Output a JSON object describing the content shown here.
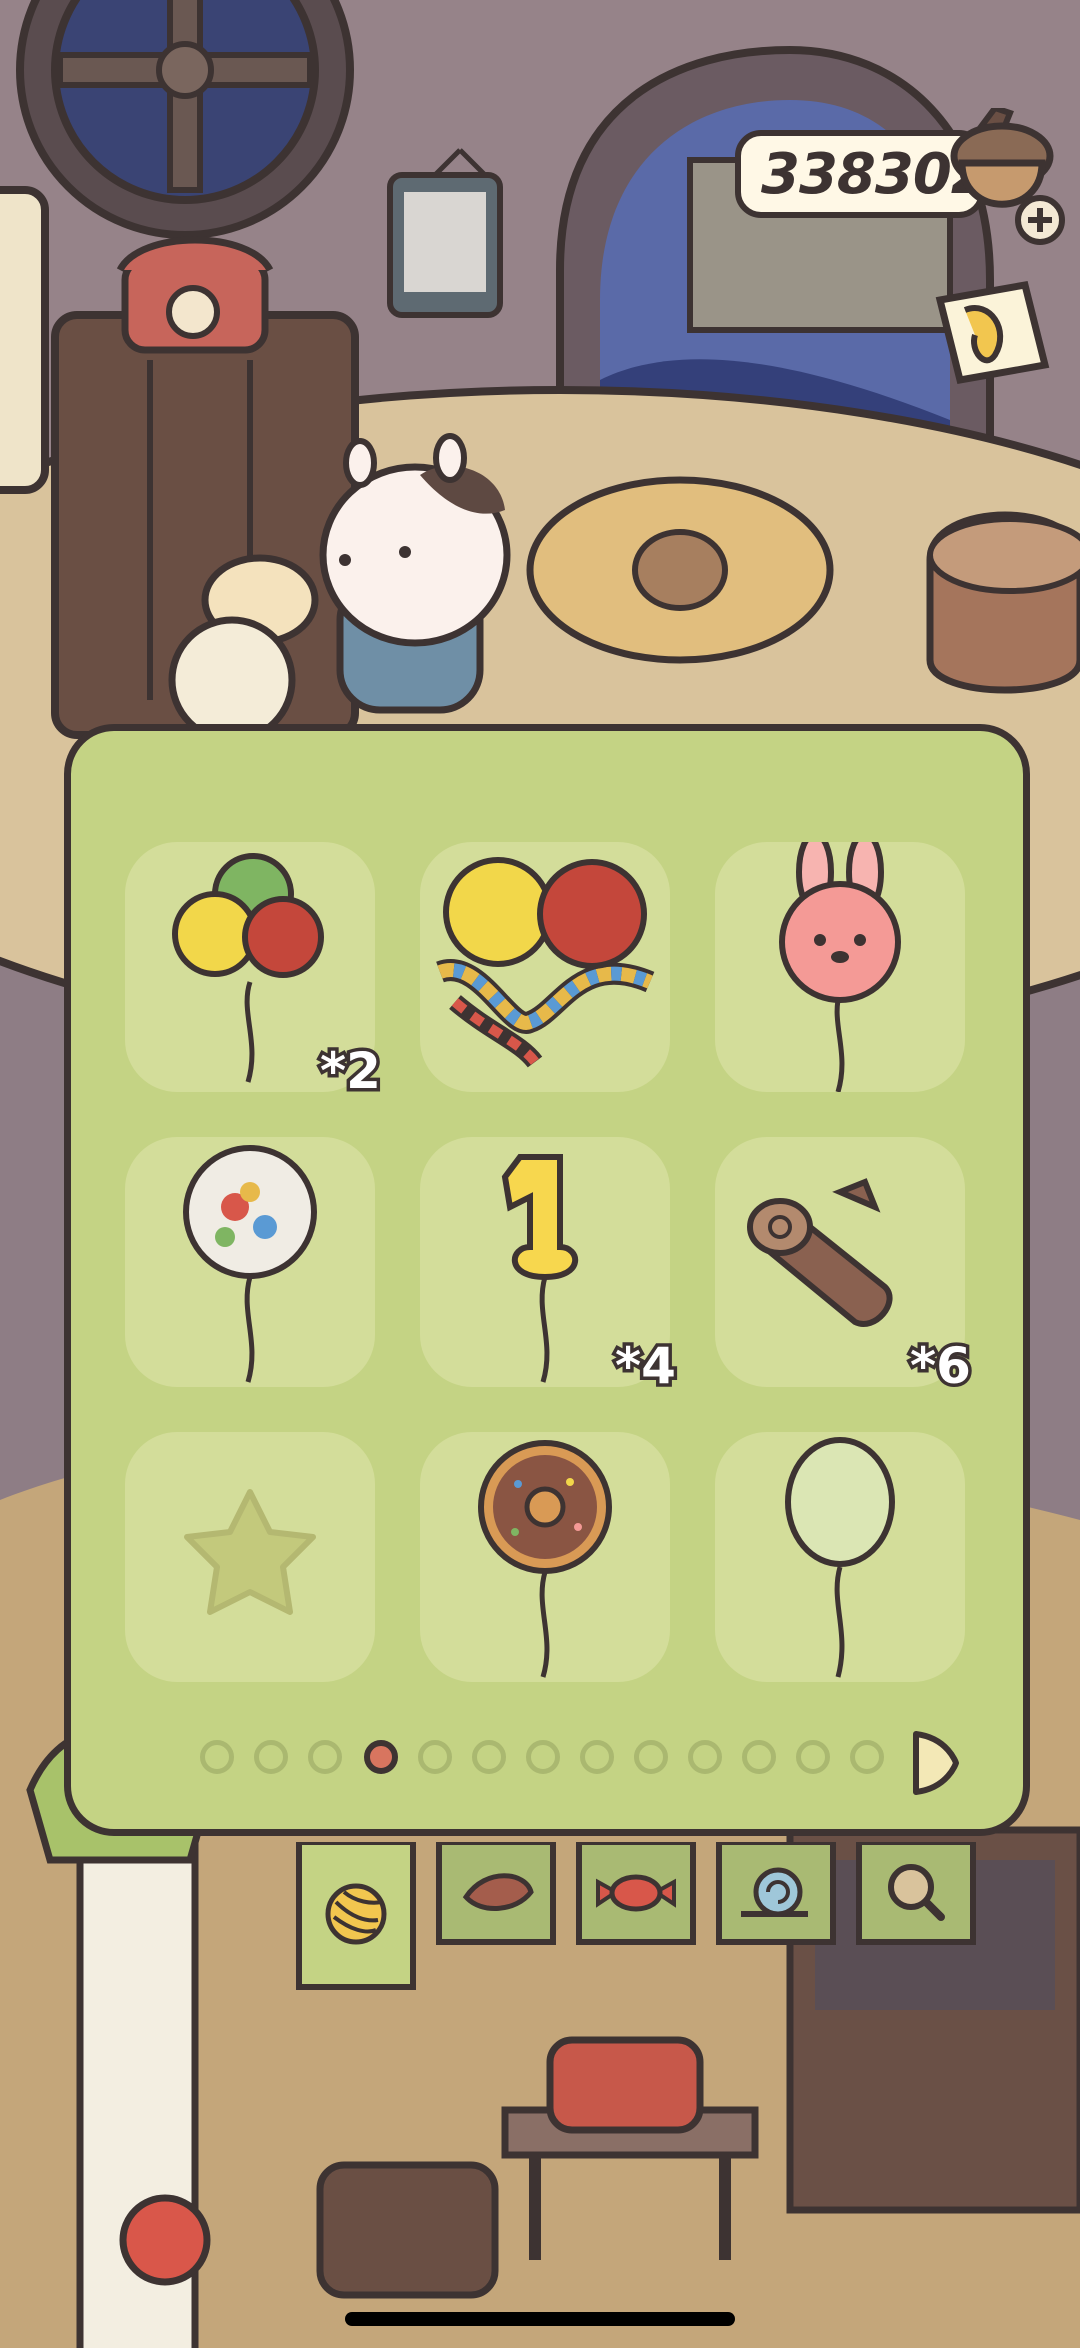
{
  "currency": {
    "amount": "338302",
    "icon": "acorn-icon",
    "add_icon": "plus-icon"
  },
  "ticket_icon": "ticket-icon",
  "inventory": {
    "items": [
      {
        "name": "balloon-bunch",
        "count": "*2"
      },
      {
        "name": "paper-chain-balloons",
        "count": ""
      },
      {
        "name": "bunny-balloon",
        "count": ""
      },
      {
        "name": "clear-balloon",
        "count": ""
      },
      {
        "name": "number-one-balloon",
        "count": "*4"
      },
      {
        "name": "log",
        "count": "*6"
      },
      {
        "name": "star-balloon-locked",
        "count": ""
      },
      {
        "name": "donut-balloon",
        "count": ""
      },
      {
        "name": "green-balloon",
        "count": ""
      }
    ],
    "page_count": 13,
    "current_page": 4
  },
  "category_tabs": [
    {
      "name": "yarn-ball-icon"
    },
    {
      "name": "leaf-icon"
    },
    {
      "name": "candy-icon"
    },
    {
      "name": "snail-icon"
    },
    {
      "name": "magnifier-icon"
    }
  ],
  "colors": {
    "panel": "#c4d384",
    "slot": "#d3dd9a",
    "outline": "#3d3332",
    "active_dot": "#d8755f"
  }
}
